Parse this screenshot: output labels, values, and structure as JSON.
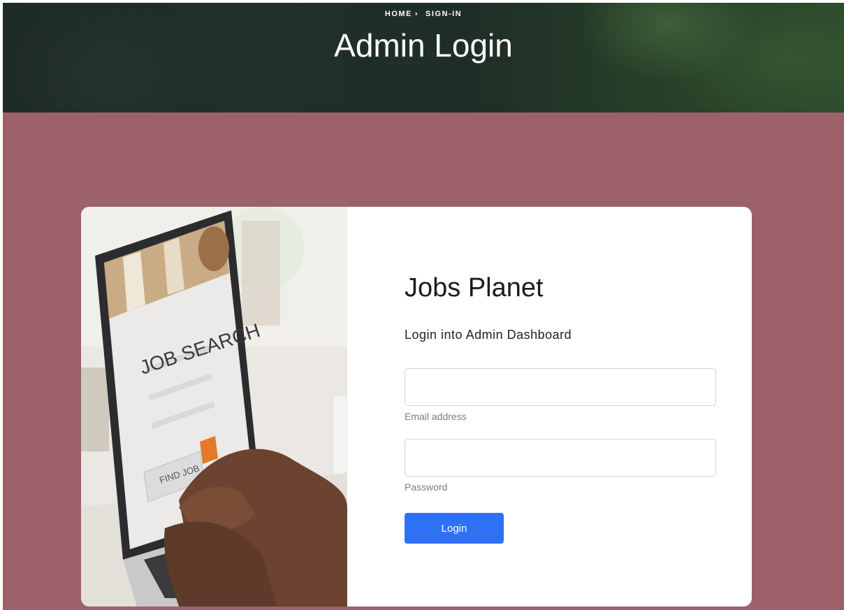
{
  "hero": {
    "breadcrumb": [
      {
        "label": "HOME"
      },
      {
        "separator": "›"
      },
      {
        "label": "SIGN-IN"
      }
    ],
    "title": "Admin Login"
  },
  "illustration": {
    "headline": "JOB SEARCH",
    "button_label": "FIND JOB"
  },
  "form": {
    "brand": "Jobs Planet",
    "subtitle": "Login into Admin Dashboard",
    "email_label": "Email address",
    "email_value": "",
    "password_label": "Password",
    "password_value": "",
    "login_label": "Login"
  },
  "colors": {
    "page_background": "#9c616b",
    "button": "#2f71f5",
    "card": "#ffffff"
  }
}
